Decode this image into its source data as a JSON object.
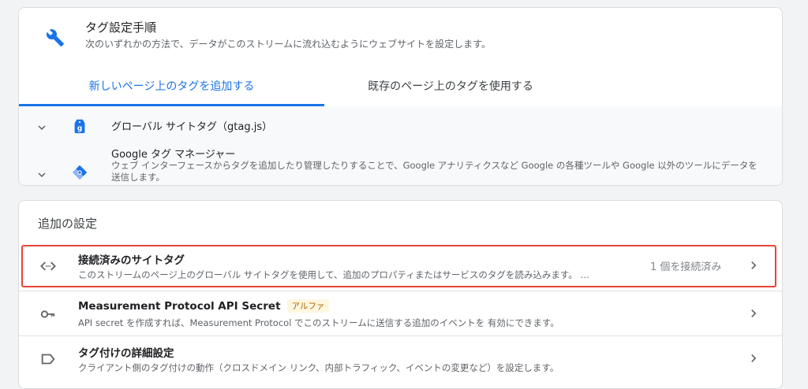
{
  "setup": {
    "title": "タグ設定手順",
    "subtitle": "次のいずれかの方法で、データがこのストリームに流れ込むようにウェブサイトを設定します。"
  },
  "tabs": [
    {
      "label": "新しいページ上のタグを追加する",
      "active": true
    },
    {
      "label": "既存のページ上のタグを使用する",
      "active": false
    }
  ],
  "options": [
    {
      "title": "グローバル サイトタグ（gtag.js）",
      "icon": "gtag-icon"
    },
    {
      "title": "Google タグ マネージャー",
      "icon": "tag-manager-icon",
      "description": "ウェブ インターフェースからタグを追加したり管理したりすることで、Google アナリティクスなど Google の各種ツールや Google 以外のツールにデータを送信します。"
    }
  ],
  "additional": {
    "title": "追加の設定",
    "items": [
      {
        "title": "接続済みのサイトタグ",
        "description": "このストリームのページ上のグローバル サイトタグを使用して、追加のプロパティまたはサービスのタグを読み込みます。 …",
        "status": "1 個を接続済み",
        "icon": "code-icon"
      },
      {
        "title": "Measurement Protocol API Secret",
        "badge": "アルファ",
        "description": "API secret を作成すれば、Measurement Protocol でこのストリームに送信する追加のイベントを 有効にできます。",
        "icon": "key-icon"
      },
      {
        "title": "タグ付けの詳細設定",
        "description": "クライアント側のタグ付けの動作（クロスドメイン リンク、内部トラフィック、イベントの変更など）を設定します。",
        "icon": "label-icon"
      }
    ]
  },
  "colors": {
    "accent": "#1a73e8",
    "highlight": "#ea4335",
    "badge_bg": "#fef7e0"
  }
}
